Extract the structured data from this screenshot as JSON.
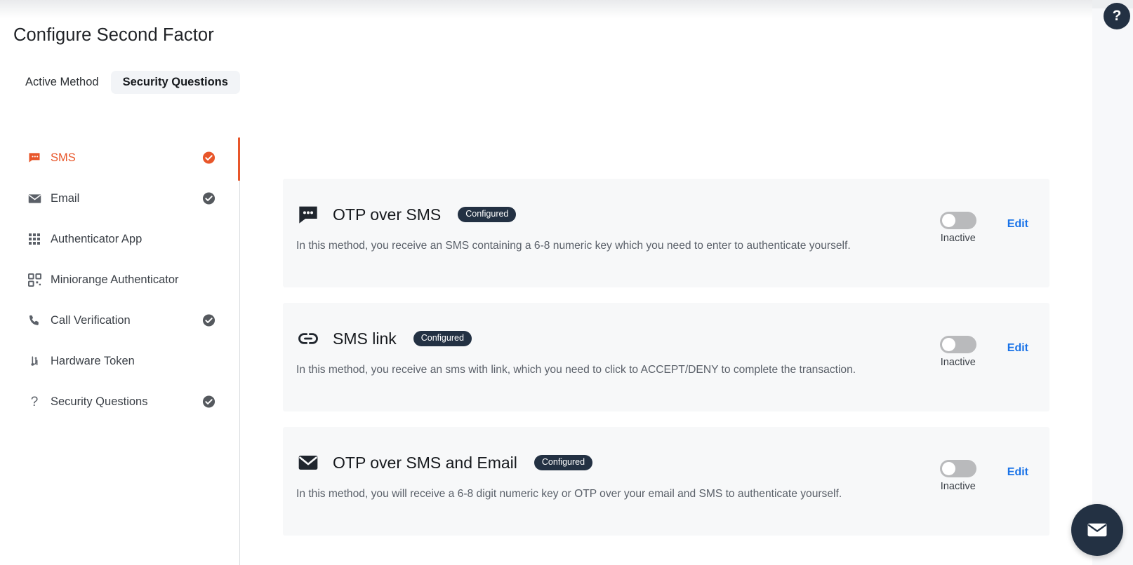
{
  "page": {
    "title": "Configure Second Factor"
  },
  "tabs": [
    {
      "label": "Active Method",
      "active": false,
      "name": "tab-active-method"
    },
    {
      "label": "Security Questions",
      "active": true,
      "name": "tab-security-questions"
    }
  ],
  "sidebar": {
    "items": [
      {
        "label": "SMS",
        "icon": "sms-icon",
        "active": true,
        "configured": true,
        "check_color": "#e8562a"
      },
      {
        "label": "Email",
        "icon": "email-icon",
        "active": false,
        "configured": true,
        "check_color": "#55595e"
      },
      {
        "label": "Authenticator App",
        "icon": "grid-dots-icon",
        "active": false,
        "configured": false,
        "check_color": ""
      },
      {
        "label": "Miniorange Authenticator",
        "icon": "qr-code-icon",
        "active": false,
        "configured": false,
        "check_color": ""
      },
      {
        "label": "Call Verification",
        "icon": "phone-icon",
        "active": false,
        "configured": true,
        "check_color": "#55595e"
      },
      {
        "label": "Hardware Token",
        "icon": "hardware-token-icon",
        "active": false,
        "configured": false,
        "check_color": ""
      },
      {
        "label": "Security Questions",
        "icon": "question-mark-icon",
        "active": false,
        "configured": true,
        "check_color": "#55595e"
      }
    ]
  },
  "cards": [
    {
      "title": "OTP over SMS",
      "badge": "Configured",
      "description": "In this method, you receive an SMS containing a 6-8 numeric key which you need to enter to authenticate yourself.",
      "toggle_state": "Inactive",
      "edit_label": "Edit",
      "icon": "chat-bubble-icon"
    },
    {
      "title": "SMS link",
      "badge": "Configured",
      "description": "In this method, you receive an sms with link, which you need to click to ACCEPT/DENY to complete the transaction.",
      "toggle_state": "Inactive",
      "edit_label": "Edit",
      "icon": "link-icon"
    },
    {
      "title": "OTP over SMS and Email",
      "badge": "Configured",
      "description": "In this method, you will receive a 6-8 digit numeric key or OTP over your email and SMS to authenticate yourself.",
      "toggle_state": "Inactive",
      "edit_label": "Edit",
      "icon": "envelope-icon"
    }
  ],
  "floating": {
    "help_label": "?",
    "mail_icon": "envelope-icon"
  },
  "colors": {
    "accent_orange": "#e8562a",
    "link_blue": "#1a73e8",
    "badge_navy": "#233143",
    "card_bg": "#f7f8f9"
  }
}
